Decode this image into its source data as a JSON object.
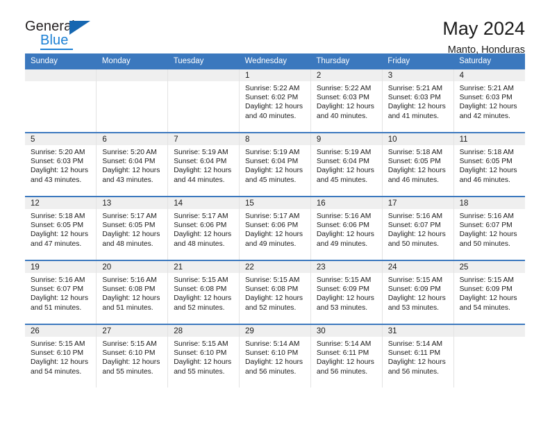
{
  "logo": {
    "word_general": "General",
    "word_blue": "Blue",
    "accent_color": "#1667B1",
    "text_color": "#231F20"
  },
  "header": {
    "title": "May 2024",
    "subtitle": "Manto, Honduras",
    "header_bg": "#3B78BE",
    "row_divider_color": "#3B78BE",
    "daynum_band_bg": "#EFEFEF"
  },
  "weekday_headers": [
    "Sunday",
    "Monday",
    "Tuesday",
    "Wednesday",
    "Thursday",
    "Friday",
    "Saturday"
  ],
  "weeks": [
    [
      {
        "day": "",
        "sunrise": "",
        "sunset": "",
        "daylight_line1": "",
        "daylight_line2": ""
      },
      {
        "day": "",
        "sunrise": "",
        "sunset": "",
        "daylight_line1": "",
        "daylight_line2": ""
      },
      {
        "day": "",
        "sunrise": "",
        "sunset": "",
        "daylight_line1": "",
        "daylight_line2": ""
      },
      {
        "day": "1",
        "sunrise": "Sunrise: 5:22 AM",
        "sunset": "Sunset: 6:02 PM",
        "daylight_line1": "Daylight: 12 hours",
        "daylight_line2": "and 40 minutes."
      },
      {
        "day": "2",
        "sunrise": "Sunrise: 5:22 AM",
        "sunset": "Sunset: 6:03 PM",
        "daylight_line1": "Daylight: 12 hours",
        "daylight_line2": "and 40 minutes."
      },
      {
        "day": "3",
        "sunrise": "Sunrise: 5:21 AM",
        "sunset": "Sunset: 6:03 PM",
        "daylight_line1": "Daylight: 12 hours",
        "daylight_line2": "and 41 minutes."
      },
      {
        "day": "4",
        "sunrise": "Sunrise: 5:21 AM",
        "sunset": "Sunset: 6:03 PM",
        "daylight_line1": "Daylight: 12 hours",
        "daylight_line2": "and 42 minutes."
      }
    ],
    [
      {
        "day": "5",
        "sunrise": "Sunrise: 5:20 AM",
        "sunset": "Sunset: 6:03 PM",
        "daylight_line1": "Daylight: 12 hours",
        "daylight_line2": "and 43 minutes."
      },
      {
        "day": "6",
        "sunrise": "Sunrise: 5:20 AM",
        "sunset": "Sunset: 6:04 PM",
        "daylight_line1": "Daylight: 12 hours",
        "daylight_line2": "and 43 minutes."
      },
      {
        "day": "7",
        "sunrise": "Sunrise: 5:19 AM",
        "sunset": "Sunset: 6:04 PM",
        "daylight_line1": "Daylight: 12 hours",
        "daylight_line2": "and 44 minutes."
      },
      {
        "day": "8",
        "sunrise": "Sunrise: 5:19 AM",
        "sunset": "Sunset: 6:04 PM",
        "daylight_line1": "Daylight: 12 hours",
        "daylight_line2": "and 45 minutes."
      },
      {
        "day": "9",
        "sunrise": "Sunrise: 5:19 AM",
        "sunset": "Sunset: 6:04 PM",
        "daylight_line1": "Daylight: 12 hours",
        "daylight_line2": "and 45 minutes."
      },
      {
        "day": "10",
        "sunrise": "Sunrise: 5:18 AM",
        "sunset": "Sunset: 6:05 PM",
        "daylight_line1": "Daylight: 12 hours",
        "daylight_line2": "and 46 minutes."
      },
      {
        "day": "11",
        "sunrise": "Sunrise: 5:18 AM",
        "sunset": "Sunset: 6:05 PM",
        "daylight_line1": "Daylight: 12 hours",
        "daylight_line2": "and 46 minutes."
      }
    ],
    [
      {
        "day": "12",
        "sunrise": "Sunrise: 5:18 AM",
        "sunset": "Sunset: 6:05 PM",
        "daylight_line1": "Daylight: 12 hours",
        "daylight_line2": "and 47 minutes."
      },
      {
        "day": "13",
        "sunrise": "Sunrise: 5:17 AM",
        "sunset": "Sunset: 6:05 PM",
        "daylight_line1": "Daylight: 12 hours",
        "daylight_line2": "and 48 minutes."
      },
      {
        "day": "14",
        "sunrise": "Sunrise: 5:17 AM",
        "sunset": "Sunset: 6:06 PM",
        "daylight_line1": "Daylight: 12 hours",
        "daylight_line2": "and 48 minutes."
      },
      {
        "day": "15",
        "sunrise": "Sunrise: 5:17 AM",
        "sunset": "Sunset: 6:06 PM",
        "daylight_line1": "Daylight: 12 hours",
        "daylight_line2": "and 49 minutes."
      },
      {
        "day": "16",
        "sunrise": "Sunrise: 5:16 AM",
        "sunset": "Sunset: 6:06 PM",
        "daylight_line1": "Daylight: 12 hours",
        "daylight_line2": "and 49 minutes."
      },
      {
        "day": "17",
        "sunrise": "Sunrise: 5:16 AM",
        "sunset": "Sunset: 6:07 PM",
        "daylight_line1": "Daylight: 12 hours",
        "daylight_line2": "and 50 minutes."
      },
      {
        "day": "18",
        "sunrise": "Sunrise: 5:16 AM",
        "sunset": "Sunset: 6:07 PM",
        "daylight_line1": "Daylight: 12 hours",
        "daylight_line2": "and 50 minutes."
      }
    ],
    [
      {
        "day": "19",
        "sunrise": "Sunrise: 5:16 AM",
        "sunset": "Sunset: 6:07 PM",
        "daylight_line1": "Daylight: 12 hours",
        "daylight_line2": "and 51 minutes."
      },
      {
        "day": "20",
        "sunrise": "Sunrise: 5:16 AM",
        "sunset": "Sunset: 6:08 PM",
        "daylight_line1": "Daylight: 12 hours",
        "daylight_line2": "and 51 minutes."
      },
      {
        "day": "21",
        "sunrise": "Sunrise: 5:15 AM",
        "sunset": "Sunset: 6:08 PM",
        "daylight_line1": "Daylight: 12 hours",
        "daylight_line2": "and 52 minutes."
      },
      {
        "day": "22",
        "sunrise": "Sunrise: 5:15 AM",
        "sunset": "Sunset: 6:08 PM",
        "daylight_line1": "Daylight: 12 hours",
        "daylight_line2": "and 52 minutes."
      },
      {
        "day": "23",
        "sunrise": "Sunrise: 5:15 AM",
        "sunset": "Sunset: 6:09 PM",
        "daylight_line1": "Daylight: 12 hours",
        "daylight_line2": "and 53 minutes."
      },
      {
        "day": "24",
        "sunrise": "Sunrise: 5:15 AM",
        "sunset": "Sunset: 6:09 PM",
        "daylight_line1": "Daylight: 12 hours",
        "daylight_line2": "and 53 minutes."
      },
      {
        "day": "25",
        "sunrise": "Sunrise: 5:15 AM",
        "sunset": "Sunset: 6:09 PM",
        "daylight_line1": "Daylight: 12 hours",
        "daylight_line2": "and 54 minutes."
      }
    ],
    [
      {
        "day": "26",
        "sunrise": "Sunrise: 5:15 AM",
        "sunset": "Sunset: 6:10 PM",
        "daylight_line1": "Daylight: 12 hours",
        "daylight_line2": "and 54 minutes."
      },
      {
        "day": "27",
        "sunrise": "Sunrise: 5:15 AM",
        "sunset": "Sunset: 6:10 PM",
        "daylight_line1": "Daylight: 12 hours",
        "daylight_line2": "and 55 minutes."
      },
      {
        "day": "28",
        "sunrise": "Sunrise: 5:15 AM",
        "sunset": "Sunset: 6:10 PM",
        "daylight_line1": "Daylight: 12 hours",
        "daylight_line2": "and 55 minutes."
      },
      {
        "day": "29",
        "sunrise": "Sunrise: 5:14 AM",
        "sunset": "Sunset: 6:10 PM",
        "daylight_line1": "Daylight: 12 hours",
        "daylight_line2": "and 56 minutes."
      },
      {
        "day": "30",
        "sunrise": "Sunrise: 5:14 AM",
        "sunset": "Sunset: 6:11 PM",
        "daylight_line1": "Daylight: 12 hours",
        "daylight_line2": "and 56 minutes."
      },
      {
        "day": "31",
        "sunrise": "Sunrise: 5:14 AM",
        "sunset": "Sunset: 6:11 PM",
        "daylight_line1": "Daylight: 12 hours",
        "daylight_line2": "and 56 minutes."
      },
      {
        "day": "",
        "sunrise": "",
        "sunset": "",
        "daylight_line1": "",
        "daylight_line2": ""
      }
    ]
  ]
}
